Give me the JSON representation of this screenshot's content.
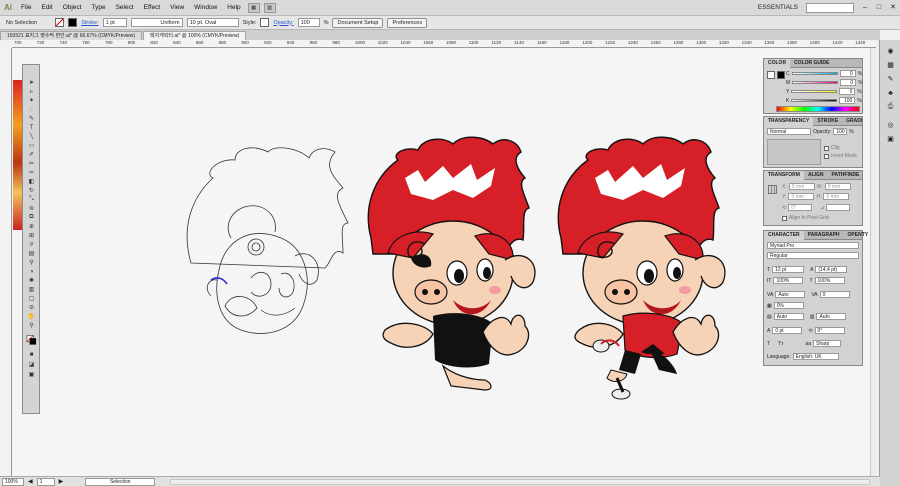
{
  "app": {
    "logo": "Ai",
    "workspace": "ESSENTIALS"
  },
  "menu": [
    "File",
    "Edit",
    "Object",
    "Type",
    "Select",
    "Effect",
    "View",
    "Window",
    "Help"
  ],
  "control_bar": {
    "selection_label": "No Selection",
    "stroke_label": "Stroke:",
    "stroke_weight": "1 pt",
    "stroke_profile": "Uniform",
    "brush": "10 pt. Oval",
    "style_label": "Style:",
    "opacity_label": "Opacity:",
    "opacity_value": "100",
    "opacity_unit": "%",
    "document_setup": "Document Setup",
    "preferences": "Preferences"
  },
  "tabs": [
    {
      "label": "150521 표지그 영수막 편안.ai* @ 66.67% (CMYK/Preview)",
      "active": false
    },
    {
      "label": "돼지캐릭터.ai* @ 100% (CMYK/Preview)",
      "active": true
    }
  ],
  "ruler": [
    "700",
    "720",
    "740",
    "760",
    "780",
    "800",
    "820",
    "840",
    "860",
    "880",
    "900",
    "920",
    "940",
    "960",
    "980",
    "1000",
    "1020",
    "1040",
    "1060",
    "1080",
    "1100",
    "1120",
    "1140",
    "1160",
    "1180",
    "1200",
    "1220",
    "1240",
    "1260",
    "1280",
    "1300",
    "1320",
    "1340",
    "1360",
    "1380",
    "1400",
    "1420",
    "1440"
  ],
  "color_panel": {
    "tabs": [
      "COLOR",
      "COLOR GUIDE"
    ],
    "channels": [
      {
        "name": "C",
        "value": "0"
      },
      {
        "name": "M",
        "value": "0"
      },
      {
        "name": "Y",
        "value": "0"
      },
      {
        "name": "K",
        "value": "100"
      }
    ],
    "unit": "%"
  },
  "transparency_panel": {
    "tabs": [
      "TRANSPARENCY",
      "STROKE",
      "GRADI"
    ],
    "mode": "Normal",
    "opacity_label": "Opacity:",
    "opacity": "100",
    "unit": "%",
    "clip": "Clip",
    "invert_mask": "Invert Mask"
  },
  "transform_panel": {
    "tabs": [
      "TRANSFORM",
      "ALIGN",
      "PATHFINDE"
    ],
    "x_label": "X:",
    "x": "0 mm",
    "y_label": "Y:",
    "y": "0 mm",
    "w_label": "W:",
    "w": "0 mm",
    "h_label": "H:",
    "h": "0 mm",
    "angle": "0°",
    "align_to_pixel_grid": "Align to Pixel Grid"
  },
  "character_panel": {
    "tabs": [
      "CHARACTER",
      "PARAGRAPH",
      "OPENTY"
    ],
    "font": "Myriad Pro",
    "style": "Regular",
    "size": "12 pt",
    "leading": "(14.4 pt)",
    "hscale": "100%",
    "vscale": "100%",
    "kerning": "Auto",
    "tracking": "0",
    "tsume": "0%",
    "aki_left": "Auto",
    "aki_right": "Auto",
    "baseline": "0 pt",
    "rotation": "0°",
    "antialias": "Sharp",
    "language_label": "Language:",
    "language": "English: UK"
  },
  "status_bar": {
    "zoom": "100%",
    "artboard": "1",
    "mode": "Selection"
  },
  "colors": {
    "character_red": "#d61f26",
    "panel_bg": "#d2d2d2"
  }
}
